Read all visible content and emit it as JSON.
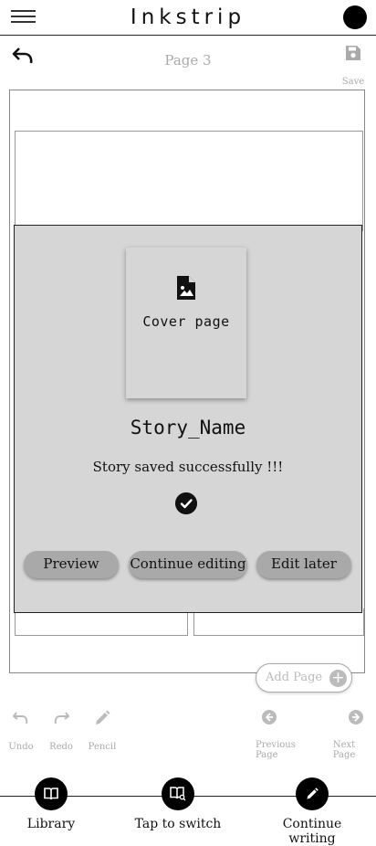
{
  "app": {
    "title": "Inkstrip"
  },
  "editor": {
    "page_label": "Page 3",
    "save_label": "Save",
    "add_page_label": "Add Page",
    "add_page_symbol": "+"
  },
  "modal": {
    "cover_label": "Cover page",
    "story_name": "Story_Name",
    "message": "Story saved successfully !!!",
    "buttons": {
      "preview": "Preview",
      "continue": "Continue editing",
      "later": "Edit later"
    }
  },
  "tools": {
    "undo": "Undo",
    "redo": "Redo",
    "pencil": "Pencil",
    "previous_page": "Previous Page",
    "next_page": "Next Page"
  },
  "bottom_nav": {
    "library": "Library",
    "switch": "Tap to switch",
    "continue_writing": "Continue writing"
  }
}
